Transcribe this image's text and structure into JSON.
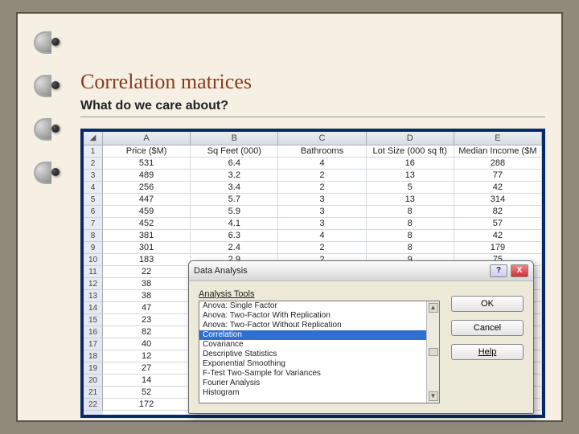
{
  "slide": {
    "title": "Correlation matrices",
    "subtitle": "What do we care about?"
  },
  "spreadsheet": {
    "columns": [
      "A",
      "B",
      "C",
      "D",
      "E"
    ],
    "headers": [
      "Price ($M)",
      "Sq Feet (000)",
      "Bathrooms",
      "Lot Size (000 sq ft)",
      "Median Income ($M"
    ],
    "rows": [
      [
        "531",
        "6.4",
        "4",
        "16",
        "288"
      ],
      [
        "489",
        "3.2",
        "2",
        "13",
        "77"
      ],
      [
        "256",
        "3.4",
        "2",
        "5",
        "42"
      ],
      [
        "447",
        "5.7",
        "3",
        "13",
        "314"
      ],
      [
        "459",
        "5.9",
        "3",
        "8",
        "82"
      ],
      [
        "452",
        "4.1",
        "3",
        "8",
        "57"
      ],
      [
        "381",
        "6.3",
        "4",
        "8",
        "42"
      ],
      [
        "301",
        "2.4",
        "2",
        "8",
        "179"
      ],
      [
        "183",
        "2.9",
        "2",
        "9",
        "75"
      ],
      [
        "22",
        "",
        "",
        "",
        ""
      ],
      [
        "38",
        "",
        "",
        "",
        ""
      ],
      [
        "38",
        "",
        "",
        "",
        ""
      ],
      [
        "47",
        "",
        "",
        "",
        ""
      ],
      [
        "23",
        "",
        "",
        "",
        ""
      ],
      [
        "82",
        "",
        "",
        "",
        ""
      ],
      [
        "40",
        "",
        "",
        "",
        ""
      ],
      [
        "12",
        "",
        "",
        "",
        ""
      ],
      [
        "27",
        "",
        "",
        "",
        ""
      ],
      [
        "14",
        "",
        "",
        "",
        ""
      ],
      [
        "52",
        "",
        "",
        "",
        ""
      ],
      [
        "172",
        "",
        "",
        "",
        ""
      ]
    ]
  },
  "dialog": {
    "title": "Data Analysis",
    "list_label": "Analysis Tools",
    "items": [
      "Anova: Single Factor",
      "Anova: Two-Factor With Replication",
      "Anova: Two-Factor Without Replication",
      "Correlation",
      "Covariance",
      "Descriptive Statistics",
      "Exponential Smoothing",
      "F-Test Two-Sample for Variances",
      "Fourier Analysis",
      "Histogram"
    ],
    "selected_index": 3,
    "buttons": {
      "ok": "OK",
      "cancel": "Cancel",
      "help": "Help"
    },
    "window_help": "?",
    "window_close": "X"
  }
}
